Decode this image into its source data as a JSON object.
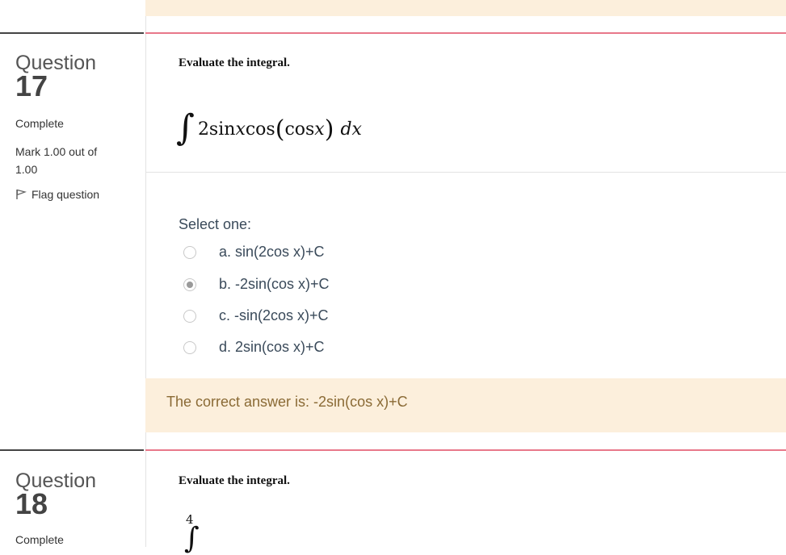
{
  "questions": [
    {
      "word": "Question",
      "number": "17",
      "state": "Complete",
      "grade": "Mark 1.00 out of 1.00",
      "flag_label": "Flag question",
      "prompt": "Evaluate the integral.",
      "integral": {
        "symbol": "∫",
        "coef": "2sin",
        "var1": "x",
        "fn": "cos",
        "open_paren": "(",
        "inner_fn": "cos",
        "var2": "x",
        "close_paren": ")",
        "dx_d": "d",
        "dx_x": "x"
      },
      "select_label": "Select one:",
      "options": [
        {
          "label": "a. sin(2cos x)+C",
          "checked": false
        },
        {
          "label": "b. -2sin(cos x)+C",
          "checked": true
        },
        {
          "label": "c. -sin(2cos x)+C",
          "checked": false
        },
        {
          "label": "d. 2sin(cos x)+C",
          "checked": false
        }
      ],
      "correct_answer": "The correct answer is: -2sin(cos x)+C"
    },
    {
      "word": "Question",
      "number": "18",
      "state": "Complete",
      "prompt": "Evaluate the integral.",
      "integral_upper": "4",
      "integral_symbol": "∫"
    }
  ],
  "colors": {
    "feedback_bg": "#fcefdc",
    "accent_rule": "#e8788a",
    "feedback_text": "#8a6a35"
  },
  "icons": {
    "flag": "flag-icon",
    "radio": "radio-button"
  }
}
